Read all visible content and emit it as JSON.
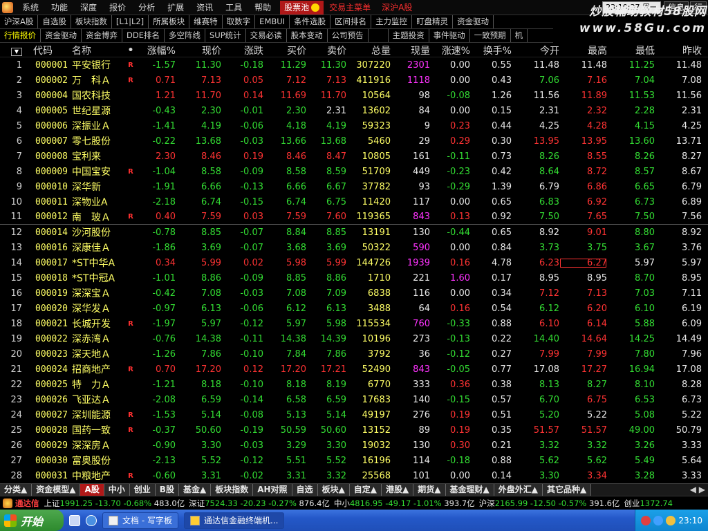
{
  "menubar": {
    "items": [
      "系统",
      "功能",
      "深度",
      "报价",
      "分析",
      "扩展",
      "资讯",
      "工具",
      "帮助"
    ],
    "pool": "股票池",
    "red_items": [
      "交易主菜单",
      "深沪A股"
    ],
    "clock": "23:10:37 周一",
    "buttons": [
      "信息",
      "行"
    ]
  },
  "watermark": {
    "title": "炒股輔助教材58股网",
    "url": "www.58Gu.com"
  },
  "tabs_row1": [
    "沪深A股",
    "自选股",
    "板块指数",
    "[L1|L2]",
    "所属板块",
    "维赛特",
    "取数字",
    "EMBUI",
    "条件选股",
    "区间排名",
    "主力监控",
    "盯盘精灵",
    "资金驱动"
  ],
  "tabs_row2": [
    "行情报价",
    "资金驱动",
    "资金博弈",
    "DDE排名",
    "多空阵线",
    "SUP统计",
    "交易必读",
    "股本变动",
    "公司预告",
    "主题投资",
    "事件驱动",
    "一致预期",
    "机"
  ],
  "table": {
    "headers": [
      "代码",
      "名称",
      "•",
      "涨幅%",
      "现价",
      "涨跌",
      "买价",
      "卖价",
      "总量",
      "现量",
      "涨速%",
      "换手%",
      "今开",
      "最高",
      "最低",
      "昨收"
    ],
    "rows": [
      {
        "n": "1",
        "code": "000001",
        "name": "平安银行",
        "flag": "R",
        "zf": "-1.57",
        "xj": "11.30",
        "zd": "-0.18",
        "mr": "11.29",
        "mc": "11.30",
        "zl": "307220",
        "xl": "2301",
        "zs": "0.00",
        "hs": "0.55",
        "jk": "11.48",
        "zg": "11.48",
        "zdi": "11.25",
        "zsh": "11.48",
        "cz": "dn",
        "cxl": "mg",
        "czs": "wh",
        "cjk": "wh",
        "czg": "wh",
        "czdi": "dn"
      },
      {
        "n": "2",
        "code": "000002",
        "name": "万　科Ａ",
        "flag": "R",
        "zf": "0.71",
        "xj": "7.13",
        "zd": "0.05",
        "mr": "7.12",
        "mc": "7.13",
        "zl": "411916",
        "xl": "1118",
        "zs": "0.00",
        "hs": "0.43",
        "jk": "7.06",
        "zg": "7.16",
        "zdi": "7.04",
        "zsh": "7.08",
        "cz": "up",
        "cxl": "mg",
        "czs": "wh",
        "cjk": "dn",
        "czg": "up",
        "czdi": "dn"
      },
      {
        "n": "3",
        "code": "000004",
        "name": "国农科技",
        "flag": "",
        "zf": "1.21",
        "xj": "11.70",
        "zd": "0.14",
        "mr": "11.69",
        "mc": "11.70",
        "zl": "10564",
        "xl": "98",
        "zs": "-0.08",
        "hs": "1.26",
        "jk": "11.56",
        "zg": "11.89",
        "zdi": "11.53",
        "zsh": "11.56",
        "cz": "up",
        "cxl": "wh",
        "czs": "dn",
        "cjk": "wh",
        "czg": "up",
        "czdi": "dn"
      },
      {
        "n": "4",
        "code": "000005",
        "name": "世纪星源",
        "flag": "",
        "zf": "-0.43",
        "xj": "2.30",
        "zd": "-0.01",
        "mr": "2.30",
        "mc": "2.31",
        "zl": "13602",
        "xl": "84",
        "zs": "0.00",
        "hs": "0.15",
        "jk": "2.31",
        "zg": "2.32",
        "zdi": "2.28",
        "zsh": "2.31",
        "cz": "dn",
        "cxl": "wh",
        "czs": "wh",
        "cjk": "wh",
        "czg": "up",
        "czdi": "dn",
        "cmc": "wh"
      },
      {
        "n": "5",
        "code": "000006",
        "name": "深振业Ａ",
        "flag": "",
        "zf": "-1.41",
        "xj": "4.19",
        "zd": "-0.06",
        "mr": "4.18",
        "mc": "4.19",
        "zl": "59323",
        "xl": "9",
        "zs": "0.23",
        "hs": "0.44",
        "jk": "4.25",
        "zg": "4.28",
        "zdi": "4.15",
        "zsh": "4.25",
        "cz": "dn",
        "cxl": "wh",
        "czs": "up",
        "cjk": "wh",
        "czg": "up",
        "czdi": "dn"
      },
      {
        "n": "6",
        "code": "000007",
        "name": "零七股份",
        "flag": "",
        "zf": "-0.22",
        "xj": "13.68",
        "zd": "-0.03",
        "mr": "13.66",
        "mc": "13.68",
        "zl": "5460",
        "xl": "29",
        "zs": "0.29",
        "hs": "0.30",
        "jk": "13.95",
        "zg": "13.95",
        "zdi": "13.60",
        "zsh": "13.71",
        "cz": "dn",
        "cxl": "wh",
        "czs": "up",
        "cjk": "up",
        "czg": "up",
        "czdi": "dn"
      },
      {
        "n": "7",
        "code": "000008",
        "name": "宝利来",
        "flag": "",
        "zf": "2.30",
        "xj": "8.46",
        "zd": "0.19",
        "mr": "8.46",
        "mc": "8.47",
        "zl": "10805",
        "xl": "161",
        "zs": "-0.11",
        "hs": "0.73",
        "jk": "8.26",
        "zg": "8.55",
        "zdi": "8.26",
        "zsh": "8.27",
        "cz": "up",
        "cxl": "wh",
        "czs": "dn",
        "cjk": "dn",
        "czg": "up",
        "czdi": "dn"
      },
      {
        "n": "8",
        "code": "000009",
        "name": "中国宝安",
        "flag": "R",
        "zf": "-1.04",
        "xj": "8.58",
        "zd": "-0.09",
        "mr": "8.58",
        "mc": "8.59",
        "zl": "51709",
        "xl": "449",
        "zs": "-0.23",
        "hs": "0.42",
        "jk": "8.64",
        "zg": "8.72",
        "zdi": "8.57",
        "zsh": "8.67",
        "cz": "dn",
        "cxl": "wh",
        "czs": "dn",
        "cjk": "dn",
        "czg": "up",
        "czdi": "dn"
      },
      {
        "n": "9",
        "code": "000010",
        "name": "深华新",
        "flag": "",
        "zf": "-1.91",
        "xj": "6.66",
        "zd": "-0.13",
        "mr": "6.66",
        "mc": "6.67",
        "zl": "37782",
        "xl": "93",
        "zs": "-0.29",
        "hs": "1.39",
        "jk": "6.79",
        "zg": "6.86",
        "zdi": "6.65",
        "zsh": "6.79",
        "cz": "dn",
        "cxl": "wh",
        "czs": "dn",
        "cjk": "wh",
        "czg": "up",
        "czdi": "dn"
      },
      {
        "n": "10",
        "code": "000011",
        "name": "深物业A",
        "flag": "",
        "zf": "-2.18",
        "xj": "6.74",
        "zd": "-0.15",
        "mr": "6.74",
        "mc": "6.75",
        "zl": "11420",
        "xl": "117",
        "zs": "0.00",
        "hs": "0.65",
        "jk": "6.83",
        "zg": "6.92",
        "zdi": "6.73",
        "zsh": "6.89",
        "cz": "dn",
        "cxl": "wh",
        "czs": "wh",
        "cjk": "dn",
        "czg": "up",
        "czdi": "dn"
      },
      {
        "n": "11",
        "code": "000012",
        "name": "南　玻Ａ",
        "flag": "R",
        "zf": "0.40",
        "xj": "7.59",
        "zd": "0.03",
        "mr": "7.59",
        "mc": "7.60",
        "zl": "119365",
        "xl": "843",
        "zs": "0.13",
        "hs": "0.92",
        "jk": "7.50",
        "zg": "7.65",
        "zdi": "7.50",
        "zsh": "7.56",
        "cz": "up",
        "cxl": "mg",
        "czs": "up",
        "cjk": "dn",
        "czg": "up",
        "czdi": "dn",
        "sep": true
      },
      {
        "n": "12",
        "code": "000014",
        "name": "沙河股份",
        "flag": "",
        "zf": "-0.78",
        "xj": "8.85",
        "zd": "-0.07",
        "mr": "8.84",
        "mc": "8.85",
        "zl": "13191",
        "xl": "130",
        "zs": "-0.44",
        "hs": "0.65",
        "jk": "8.92",
        "zg": "9.01",
        "zdi": "8.80",
        "zsh": "8.92",
        "cz": "dn",
        "cxl": "wh",
        "czs": "dn",
        "cjk": "wh",
        "czg": "up",
        "czdi": "dn"
      },
      {
        "n": "13",
        "code": "000016",
        "name": "深康佳Ａ",
        "flag": "",
        "zf": "-1.86",
        "xj": "3.69",
        "zd": "-0.07",
        "mr": "3.68",
        "mc": "3.69",
        "zl": "50322",
        "xl": "590",
        "zs": "0.00",
        "hs": "0.84",
        "jk": "3.73",
        "zg": "3.75",
        "zdi": "3.67",
        "zsh": "3.76",
        "cz": "dn",
        "cxl": "mg",
        "czs": "wh",
        "cjk": "dn",
        "czg": "dn",
        "czdi": "dn"
      },
      {
        "n": "14",
        "code": "000017",
        "name": "*ST中华A",
        "flag": "",
        "zf": "0.34",
        "xj": "5.99",
        "zd": "0.02",
        "mr": "5.98",
        "mc": "5.99",
        "zl": "144726",
        "xl": "1939",
        "zs": "0.16",
        "hs": "4.78",
        "jk": "6.23",
        "zg": "6.27",
        "zdi": "5.97",
        "zsh": "5.97",
        "cz": "up",
        "cxl": "mg",
        "czs": "up",
        "cjk": "up",
        "czg": "up",
        "czdi": "wh",
        "boxzg": true
      },
      {
        "n": "15",
        "code": "000018",
        "name": "*ST中冠A",
        "flag": "",
        "zf": "-1.01",
        "xj": "8.86",
        "zd": "-0.09",
        "mr": "8.85",
        "mc": "8.86",
        "zl": "1710",
        "xl": "221",
        "zs": "1.60",
        "hs": "0.17",
        "jk": "8.95",
        "zg": "8.95",
        "zdi": "8.70",
        "zsh": "8.95",
        "cz": "dn",
        "cxl": "wh",
        "czs": "mg",
        "cjk": "wh",
        "czg": "wh",
        "czdi": "dn"
      },
      {
        "n": "16",
        "code": "000019",
        "name": "深深宝Ａ",
        "flag": "",
        "zf": "-0.42",
        "xj": "7.08",
        "zd": "-0.03",
        "mr": "7.08",
        "mc": "7.09",
        "zl": "6838",
        "xl": "116",
        "zs": "0.00",
        "hs": "0.34",
        "jk": "7.12",
        "zg": "7.13",
        "zdi": "7.03",
        "zsh": "7.11",
        "cz": "dn",
        "cxl": "wh",
        "czs": "wh",
        "cjk": "up",
        "czg": "up",
        "czdi": "dn"
      },
      {
        "n": "17",
        "code": "000020",
        "name": "深华发Ａ",
        "flag": "",
        "zf": "-0.97",
        "xj": "6.13",
        "zd": "-0.06",
        "mr": "6.12",
        "mc": "6.13",
        "zl": "3488",
        "xl": "64",
        "zs": "0.16",
        "hs": "0.54",
        "jk": "6.12",
        "zg": "6.20",
        "zdi": "6.10",
        "zsh": "6.19",
        "cz": "dn",
        "cxl": "wh",
        "czs": "up",
        "cjk": "dn",
        "czg": "up",
        "czdi": "dn"
      },
      {
        "n": "18",
        "code": "000021",
        "name": "长城开发",
        "flag": "R",
        "zf": "-1.97",
        "xj": "5.97",
        "zd": "-0.12",
        "mr": "5.97",
        "mc": "5.98",
        "zl": "115534",
        "xl": "760",
        "zs": "-0.33",
        "hs": "0.88",
        "jk": "6.10",
        "zg": "6.14",
        "zdi": "5.88",
        "zsh": "6.09",
        "cz": "dn",
        "cxl": "mg",
        "czs": "dn",
        "cjk": "up",
        "czg": "up",
        "czdi": "dn"
      },
      {
        "n": "19",
        "code": "000022",
        "name": "深赤湾Ａ",
        "flag": "",
        "zf": "-0.76",
        "xj": "14.38",
        "zd": "-0.11",
        "mr": "14.38",
        "mc": "14.39",
        "zl": "10196",
        "xl": "273",
        "zs": "-0.13",
        "hs": "0.22",
        "jk": "14.40",
        "zg": "14.64",
        "zdi": "14.25",
        "zsh": "14.49",
        "cz": "dn",
        "cxl": "wh",
        "czs": "dn",
        "cjk": "dn",
        "czg": "up",
        "czdi": "dn"
      },
      {
        "n": "20",
        "code": "000023",
        "name": "深天地Ａ",
        "flag": "",
        "zf": "-1.26",
        "xj": "7.86",
        "zd": "-0.10",
        "mr": "7.84",
        "mc": "7.86",
        "zl": "3792",
        "xl": "36",
        "zs": "-0.12",
        "hs": "0.27",
        "jk": "7.99",
        "zg": "7.99",
        "zdi": "7.80",
        "zsh": "7.96",
        "cz": "dn",
        "cxl": "wh",
        "czs": "dn",
        "cjk": "up",
        "czg": "up",
        "czdi": "dn"
      },
      {
        "n": "21",
        "code": "000024",
        "name": "招商地产",
        "flag": "R",
        "zf": "0.70",
        "xj": "17.20",
        "zd": "0.12",
        "mr": "17.20",
        "mc": "17.21",
        "zl": "52490",
        "xl": "843",
        "zs": "-0.05",
        "hs": "0.77",
        "jk": "17.08",
        "zg": "17.27",
        "zdi": "16.94",
        "zsh": "17.08",
        "cz": "up",
        "cxl": "mg",
        "czs": "dn",
        "cjk": "wh",
        "czg": "up",
        "czdi": "dn"
      },
      {
        "n": "22",
        "code": "000025",
        "name": "特　力Ａ",
        "flag": "",
        "zf": "-1.21",
        "xj": "8.18",
        "zd": "-0.10",
        "mr": "8.18",
        "mc": "8.19",
        "zl": "6770",
        "xl": "333",
        "zs": "0.36",
        "hs": "0.38",
        "jk": "8.13",
        "zg": "8.27",
        "zdi": "8.10",
        "zsh": "8.28",
        "cz": "dn",
        "cxl": "wh",
        "czs": "up",
        "cjk": "dn",
        "czg": "dn",
        "czdi": "dn"
      },
      {
        "n": "23",
        "code": "000026",
        "name": "飞亚达Ａ",
        "flag": "",
        "zf": "-2.08",
        "xj": "6.59",
        "zd": "-0.14",
        "mr": "6.58",
        "mc": "6.59",
        "zl": "17683",
        "xl": "140",
        "zs": "-0.15",
        "hs": "0.57",
        "jk": "6.70",
        "zg": "6.75",
        "zdi": "6.53",
        "zsh": "6.73",
        "cz": "dn",
        "cxl": "wh",
        "czs": "dn",
        "cjk": "dn",
        "czg": "up",
        "czdi": "dn"
      },
      {
        "n": "24",
        "code": "000027",
        "name": "深圳能源",
        "flag": "R",
        "zf": "-1.53",
        "xj": "5.14",
        "zd": "-0.08",
        "mr": "5.13",
        "mc": "5.14",
        "zl": "49197",
        "xl": "276",
        "zs": "0.19",
        "hs": "0.51",
        "jk": "5.20",
        "zg": "5.22",
        "zdi": "5.08",
        "zsh": "5.22",
        "cz": "dn",
        "cxl": "wh",
        "czs": "up",
        "cjk": "dn",
        "czg": "wh",
        "czdi": "dn"
      },
      {
        "n": "25",
        "code": "000028",
        "name": "国药一致",
        "flag": "R",
        "zf": "-0.37",
        "xj": "50.60",
        "zd": "-0.19",
        "mr": "50.59",
        "mc": "50.60",
        "zl": "13152",
        "xl": "89",
        "zs": "0.19",
        "hs": "0.35",
        "jk": "51.57",
        "zg": "51.57",
        "zdi": "49.00",
        "zsh": "50.79",
        "cz": "dn",
        "cxl": "wh",
        "czs": "up",
        "cjk": "up",
        "czg": "up",
        "czdi": "dn"
      },
      {
        "n": "26",
        "code": "000029",
        "name": "深深房Ａ",
        "flag": "",
        "zf": "-0.90",
        "xj": "3.30",
        "zd": "-0.03",
        "mr": "3.29",
        "mc": "3.30",
        "zl": "19032",
        "xl": "130",
        "zs": "0.30",
        "hs": "0.21",
        "jk": "3.32",
        "zg": "3.32",
        "zdi": "3.26",
        "zsh": "3.33",
        "cz": "dn",
        "cxl": "wh",
        "czs": "up",
        "cjk": "dn",
        "czg": "dn",
        "czdi": "dn"
      },
      {
        "n": "27",
        "code": "000030",
        "name": "富奥股份",
        "flag": "",
        "zf": "-2.13",
        "xj": "5.52",
        "zd": "-0.12",
        "mr": "5.51",
        "mc": "5.52",
        "zl": "16196",
        "xl": "114",
        "zs": "-0.18",
        "hs": "0.88",
        "jk": "5.62",
        "zg": "5.62",
        "zdi": "5.49",
        "zsh": "5.64",
        "cz": "dn",
        "cxl": "wh",
        "czs": "dn",
        "cjk": "dn",
        "czg": "dn",
        "czdi": "dn"
      },
      {
        "n": "28",
        "code": "000031",
        "name": "中粮地产",
        "flag": "R",
        "zf": "-0.60",
        "xj": "3.31",
        "zd": "-0.02",
        "mr": "3.31",
        "mc": "3.32",
        "zl": "25568",
        "xl": "101",
        "zs": "0.00",
        "hs": "0.14",
        "jk": "3.30",
        "zg": "3.34",
        "zdi": "3.28",
        "zsh": "3.33",
        "cz": "dn",
        "cxl": "wh",
        "czs": "wh",
        "cjk": "dn",
        "czg": "up",
        "czdi": "dn"
      }
    ]
  },
  "bottom_tabs": [
    "分类▲",
    "资金模型▲",
    "A股",
    "中小",
    "创业",
    "B股",
    "基金▲",
    "板块指数",
    "AH对照",
    "自选",
    "板块▲",
    "自定▲",
    "港股▲",
    "期货▲",
    "基金理财▲",
    "外盘外汇▲",
    "其它品种▲"
  ],
  "bottom_active": "A股",
  "ticker": {
    "brand": "通达信",
    "items": [
      {
        "name": "上证",
        "a": "1991.25",
        "b": "-13.70",
        "c": "-0.68%",
        "d": "483.0亿"
      },
      {
        "name": "深证",
        "a": "7524.33",
        "b": "-20.23",
        "c": "-0.27%",
        "d": "876.4亿"
      },
      {
        "name": "中小",
        "a": "4816.95",
        "b": "-49.17",
        "c": "-1.01%",
        "d": "393.7亿"
      },
      {
        "name": "沪深",
        "a": "2165.99",
        "b": "-12.50",
        "c": "-0.57%",
        "d": "391.6亿"
      },
      {
        "name": "创业",
        "a": "1372.74",
        "b": "",
        "c": "",
        "d": ""
      }
    ]
  },
  "taskbar": {
    "start": "开始",
    "tasks": [
      "文档 - 写字板",
      "通达信金融终端机..."
    ],
    "time": "23:10"
  },
  "colors": {
    "up": "#ff3333",
    "down": "#33dd33",
    "flat": "#e8e8e8",
    "volume": "#ff33ff",
    "code": "#ffff66"
  }
}
